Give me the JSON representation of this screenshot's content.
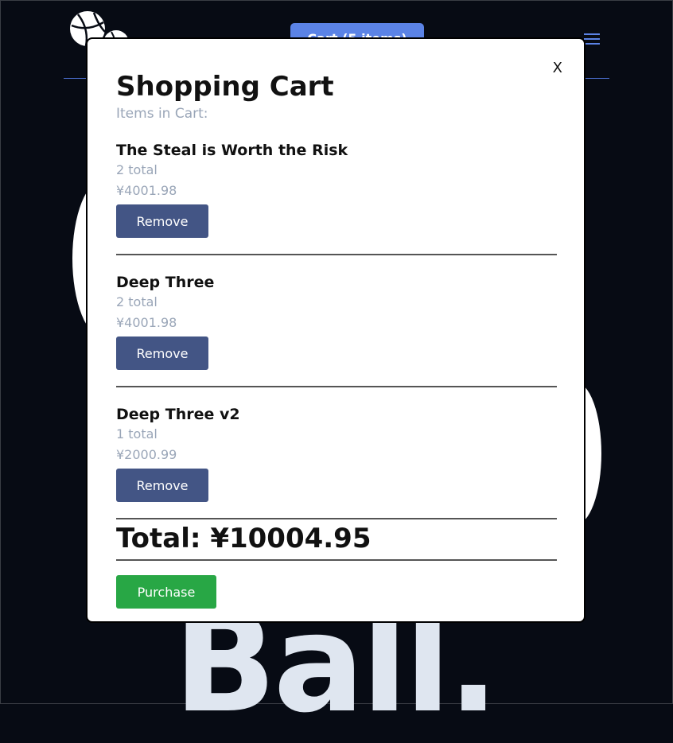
{
  "background": {
    "cart_button_label": "Cart (5 items)",
    "hero_text": "Ball."
  },
  "modal": {
    "title": "Shopping Cart",
    "subtitle": "Items in Cart:",
    "close_label": "X",
    "items": [
      {
        "name": "The Steal is Worth the Risk",
        "quantity": "2 total",
        "price": "¥4001.98",
        "remove_label": "Remove"
      },
      {
        "name": "Deep Three",
        "quantity": "2 total",
        "price": "¥4001.98",
        "remove_label": "Remove"
      },
      {
        "name": "Deep Three v2",
        "quantity": "1 total",
        "price": "¥2000.99",
        "remove_label": "Remove"
      }
    ],
    "total": "Total: ¥10004.95",
    "purchase_label": "Purchase"
  },
  "colors": {
    "page_background": "#070b14",
    "accent": "#5b83e6",
    "remove_button": "#435585",
    "purchase_button": "#28a745",
    "muted_text": "#9aa6b8"
  },
  "icons": [
    "basketball-logo-icon",
    "hamburger-menu-icon",
    "close-icon"
  ]
}
